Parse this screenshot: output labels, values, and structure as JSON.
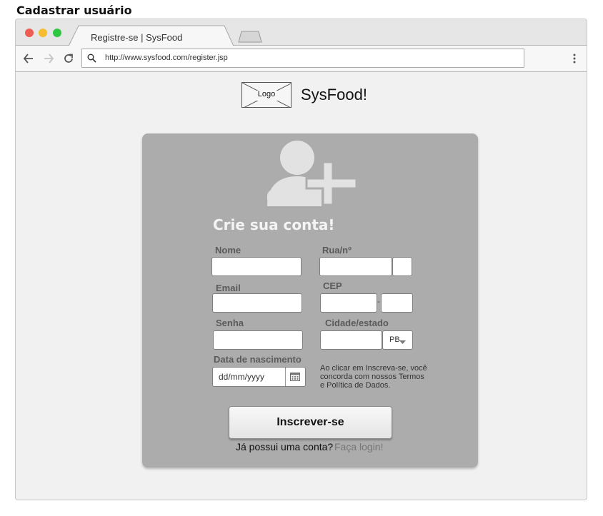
{
  "page": {
    "title": "Cadastrar usuário"
  },
  "browser": {
    "tab_title": "Registre-se | SysFood",
    "url": "http://www.sysfood.com/register.jsp",
    "icons": [
      "back-arrow-icon",
      "forward-arrow-icon",
      "reload-icon",
      "search-icon",
      "menu-dots-icon"
    ],
    "window_dot_colors": [
      "#ee5c54",
      "#f7bd31",
      "#2ec742"
    ]
  },
  "header": {
    "logo_label": "Logo",
    "brand": "SysFood!"
  },
  "form": {
    "title": "Crie sua conta!",
    "icon": "add-user-icon",
    "labels": {
      "name": "Nome",
      "email": "Email",
      "password": "Senha",
      "birthdate": "Data de nascimento",
      "street": "Rua/nº",
      "zip": "CEP",
      "city_state": "Cidade/estado"
    },
    "birthdate_placeholder": "dd/mm/yyyy",
    "zip_separator": "-",
    "state_selected": "PB",
    "terms": "Ao clicar em Inscreva-se, você concorda com nossos Termos e Política de Dados.",
    "submit": "Inscrever-se",
    "login_question": "Já possui uma conta?",
    "login_link": "Faça login!"
  },
  "colors": {
    "card": "#acacac",
    "icon": "#e2e2e2",
    "title": "#f4f4f4"
  }
}
